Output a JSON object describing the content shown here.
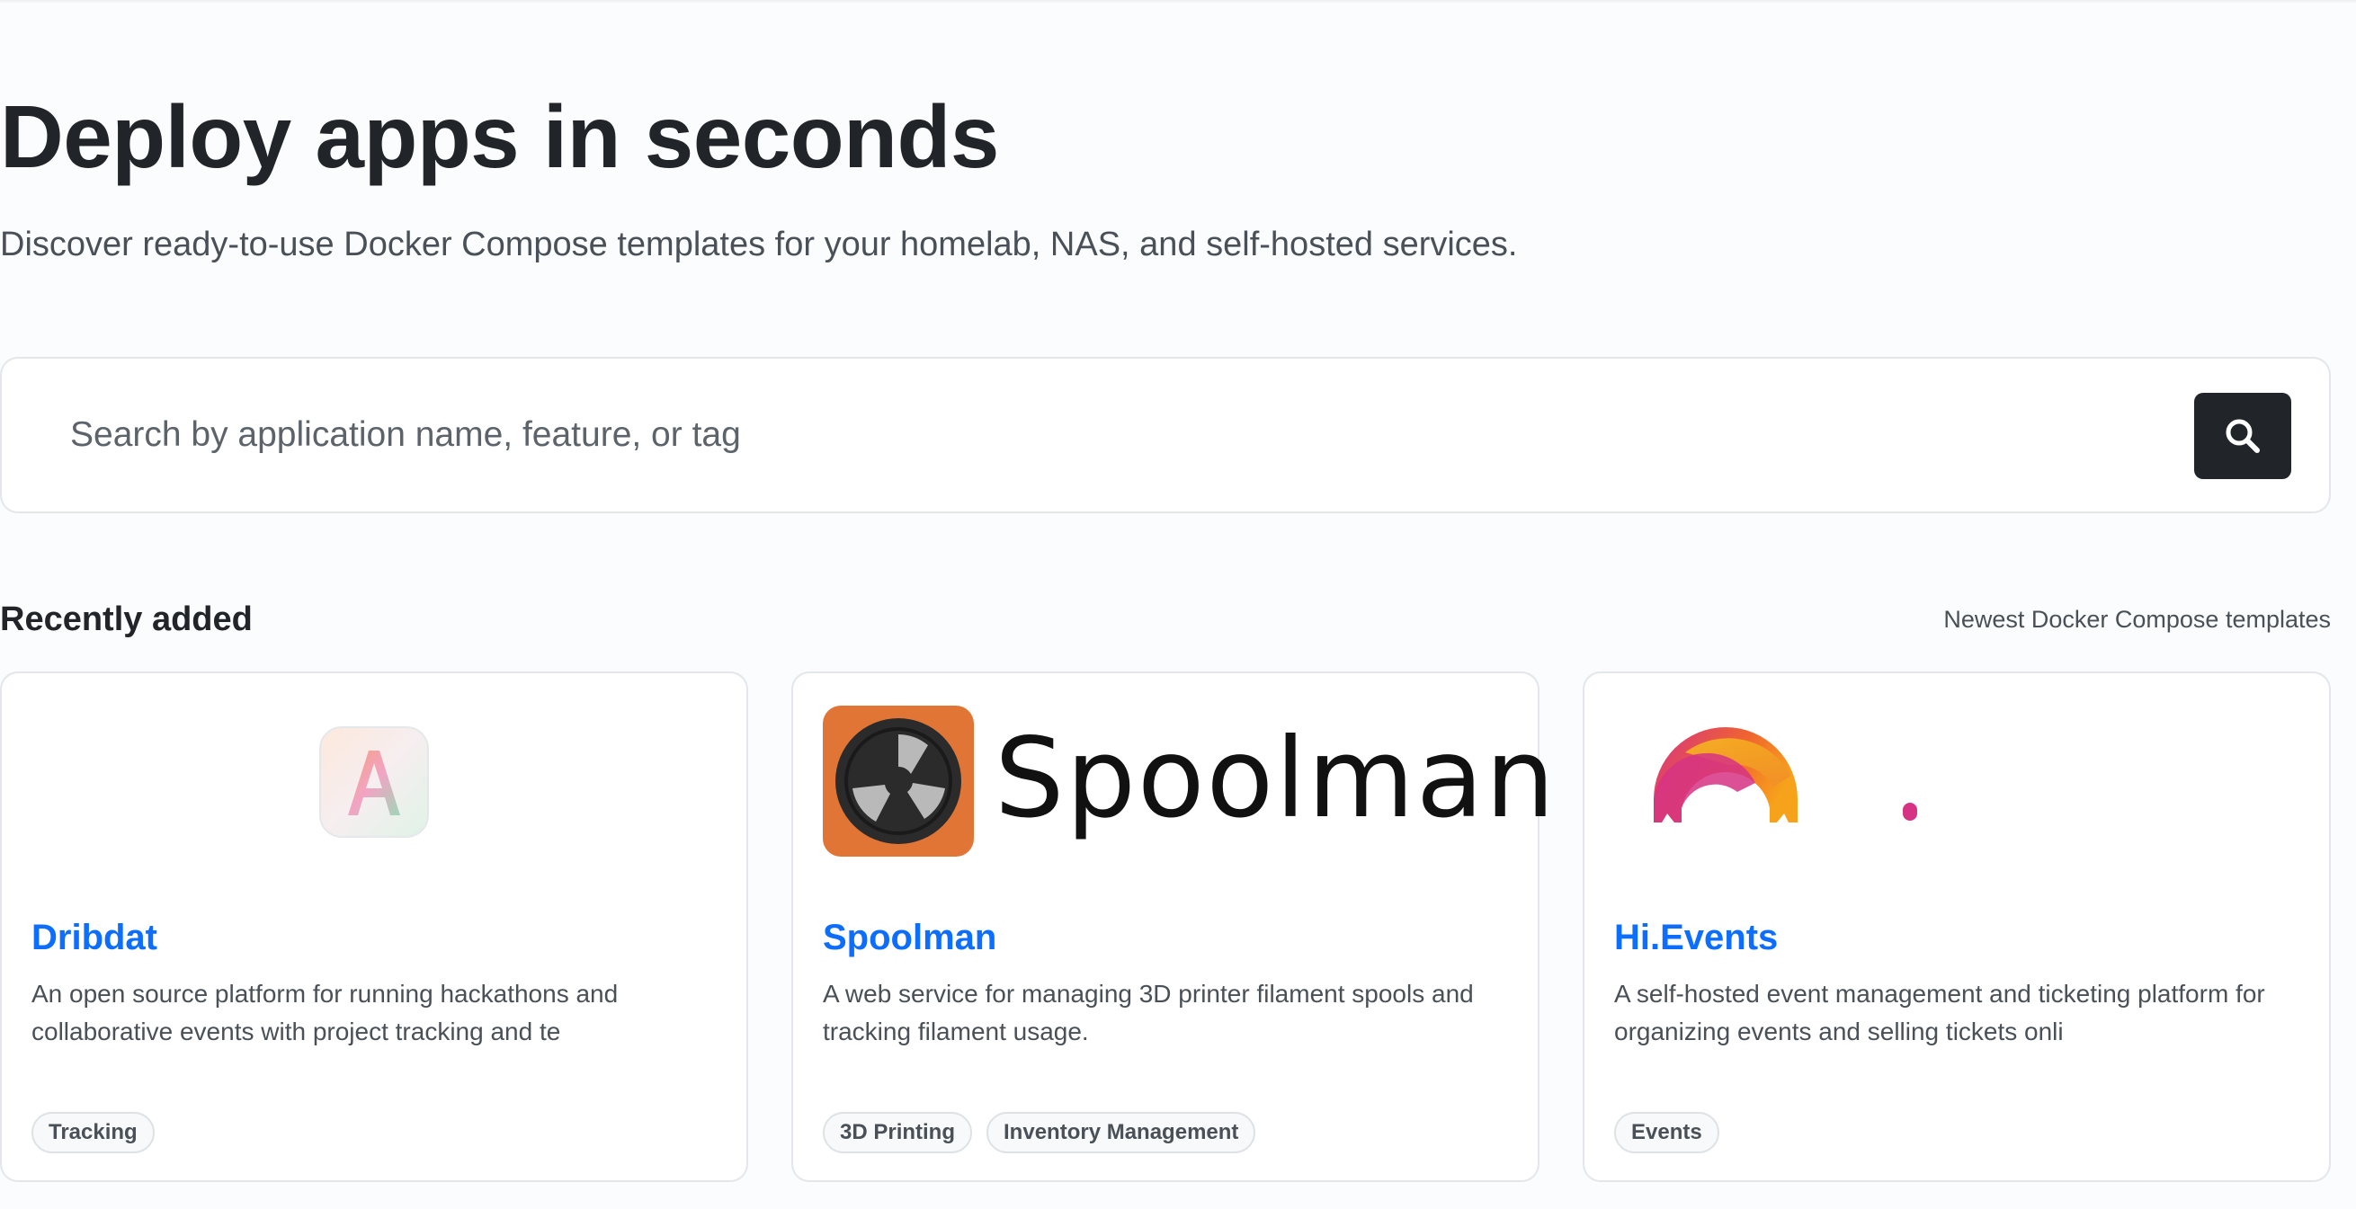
{
  "hero": {
    "title": "Deploy apps in seconds",
    "subtitle": "Discover ready-to-use Docker Compose templates for your homelab, NAS, and self-hosted services."
  },
  "search": {
    "placeholder": "Search by application name, feature, or tag",
    "icon": "search-icon"
  },
  "recent": {
    "title": "Recently added",
    "subtitle": "Newest Docker Compose templates"
  },
  "cards": [
    {
      "name": "Dribdat",
      "description": "An open source platform for running hackathons and collaborative events with project tracking and te",
      "tags": [
        "Tracking"
      ],
      "logo_letter": "A"
    },
    {
      "name": "Spoolman",
      "description": "A web service for managing 3D printer filament spools and tracking filament usage.",
      "tags": [
        "3D Printing",
        "Inventory Management"
      ],
      "logo_text": "Spoolman"
    },
    {
      "name": "Hi.Events",
      "description": "A self-hosted event management and ticketing platform for organizing events and selling tickets onli",
      "tags": [
        "Events"
      ]
    }
  ],
  "colors": {
    "accent": "#0d6efd",
    "dark": "#212529",
    "spoolman_orange": "#e07535",
    "hievents_pink": "#d63384",
    "hievents_orange": "#f7a21b"
  }
}
